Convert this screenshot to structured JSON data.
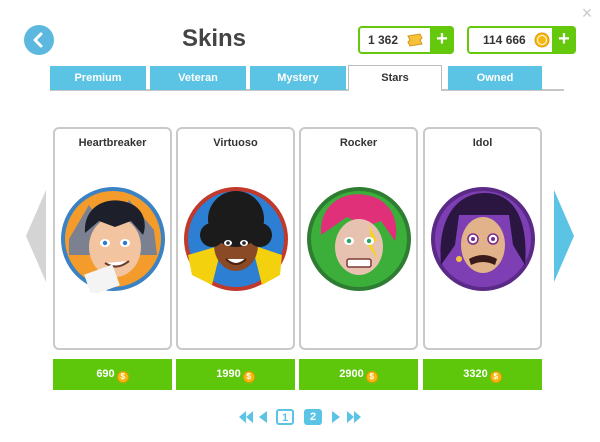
{
  "window": {
    "title": "Skins",
    "close_glyph": "×"
  },
  "currencies": {
    "tickets": {
      "amount": "1 362",
      "icon": "ticket-icon",
      "plus": "+"
    },
    "coins": {
      "amount": "114 666",
      "icon": "coin-icon",
      "plus": "+"
    }
  },
  "tabs": [
    {
      "label": "Premium",
      "active": false
    },
    {
      "label": "Veteran",
      "active": false
    },
    {
      "label": "Mystery",
      "active": false
    },
    {
      "label": "Stars",
      "active": true
    },
    {
      "label": "Owned",
      "active": false
    }
  ],
  "skins": [
    {
      "name": "Heartbreaker",
      "price": "690",
      "ring": "#3b82c4"
    },
    {
      "name": "Virtuoso",
      "price": "1990",
      "ring": "#c0392b"
    },
    {
      "name": "Rocker",
      "price": "2900",
      "ring": "#2e7d32"
    },
    {
      "name": "Idol",
      "price": "3320",
      "ring": "#5b2a86"
    }
  ],
  "coin_glyph": "$",
  "pagination": {
    "pages": [
      "1",
      "2"
    ],
    "current": "2"
  },
  "colors": {
    "accent_blue": "#5bc3e4",
    "accent_green": "#5ec70c"
  }
}
